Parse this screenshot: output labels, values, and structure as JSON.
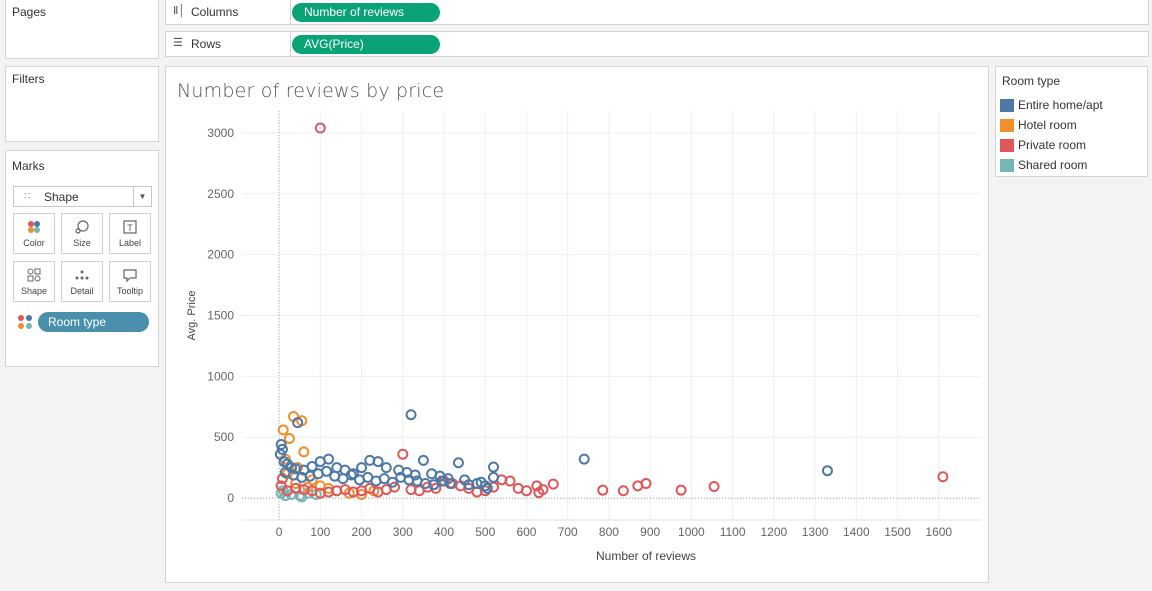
{
  "panels": {
    "pages_title": "Pages",
    "filters_title": "Filters",
    "marks_title": "Marks"
  },
  "marks": {
    "mark_type": "Shape",
    "buttons": [
      {
        "label": "Color",
        "icon": "color-icon"
      },
      {
        "label": "Size",
        "icon": "size-icon"
      },
      {
        "label": "Label",
        "icon": "label-icon"
      },
      {
        "label": "Shape",
        "icon": "shape-icon"
      },
      {
        "label": "Detail",
        "icon": "detail-icon"
      },
      {
        "label": "Tooltip",
        "icon": "tooltip-icon"
      }
    ],
    "color_pill": "Room type"
  },
  "shelves": {
    "columns_label": "Columns",
    "columns_pill": "Number of reviews",
    "rows_label": "Rows",
    "rows_pill": "AVG(Price)"
  },
  "legend": {
    "title": "Room type",
    "items": [
      {
        "label": "Entire home/apt",
        "color": "#4e79a7"
      },
      {
        "label": "Hotel room",
        "color": "#f28e2b"
      },
      {
        "label": "Private room",
        "color": "#e15759"
      },
      {
        "label": "Shared room",
        "color": "#76b7b2"
      }
    ]
  },
  "colors": {
    "pill_dimension": "#4a90ad",
    "pill_measure": "#0aa377"
  },
  "chart_data": {
    "type": "scatter",
    "title": "Number of reviews by price",
    "xlabel": "Number of reviews",
    "ylabel": "Avg. Price",
    "xlim": [
      -90,
      1700
    ],
    "ylim": [
      -180,
      3180
    ],
    "xticks": [
      0,
      100,
      200,
      300,
      400,
      500,
      600,
      700,
      800,
      900,
      1000,
      1100,
      1200,
      1300,
      1400,
      1500,
      1600
    ],
    "yticks": [
      0,
      500,
      1000,
      1500,
      2000,
      2500,
      3000
    ],
    "grid": true,
    "legend_position": "right",
    "series": [
      {
        "name": "Entire home/apt",
        "color": "#4e79a7",
        "points": [
          [
            320,
            685
          ],
          [
            45,
            620
          ],
          [
            1330,
            225
          ],
          [
            740,
            320
          ],
          [
            520,
            255
          ],
          [
            435,
            290
          ],
          [
            5,
            440
          ],
          [
            8,
            400
          ],
          [
            3,
            360
          ],
          [
            12,
            300
          ],
          [
            20,
            280
          ],
          [
            30,
            250
          ],
          [
            40,
            240
          ],
          [
            60,
            230
          ],
          [
            80,
            260
          ],
          [
            100,
            300
          ],
          [
            120,
            320
          ],
          [
            140,
            250
          ],
          [
            160,
            230
          ],
          [
            180,
            200
          ],
          [
            200,
            250
          ],
          [
            220,
            310
          ],
          [
            240,
            300
          ],
          [
            260,
            250
          ],
          [
            290,
            230
          ],
          [
            310,
            210
          ],
          [
            330,
            190
          ],
          [
            350,
            310
          ],
          [
            370,
            200
          ],
          [
            390,
            180
          ],
          [
            410,
            160
          ],
          [
            450,
            150
          ],
          [
            480,
            120
          ],
          [
            500,
            100
          ],
          [
            520,
            170
          ],
          [
            15,
            210
          ],
          [
            35,
            190
          ],
          [
            55,
            170
          ],
          [
            75,
            180
          ],
          [
            95,
            200
          ],
          [
            115,
            220
          ],
          [
            135,
            180
          ],
          [
            155,
            160
          ],
          [
            175,
            190
          ],
          [
            195,
            150
          ],
          [
            215,
            170
          ],
          [
            235,
            140
          ],
          [
            255,
            160
          ],
          [
            275,
            130
          ],
          [
            295,
            170
          ],
          [
            315,
            150
          ],
          [
            335,
            140
          ],
          [
            355,
            120
          ],
          [
            375,
            110
          ],
          [
            395,
            140
          ],
          [
            415,
            120
          ],
          [
            460,
            110
          ],
          [
            490,
            130
          ],
          [
            505,
            80
          ]
        ]
      },
      {
        "name": "Hotel room",
        "color": "#f28e2b",
        "points": [
          [
            35,
            670
          ],
          [
            55,
            635
          ],
          [
            10,
            560
          ],
          [
            25,
            490
          ],
          [
            60,
            380
          ],
          [
            15,
            320
          ],
          [
            45,
            250
          ],
          [
            80,
            150
          ],
          [
            100,
            100
          ],
          [
            120,
            80
          ],
          [
            140,
            60
          ],
          [
            170,
            40
          ],
          [
            200,
            30
          ],
          [
            230,
            60
          ],
          [
            40,
            120
          ],
          [
            70,
            90
          ],
          [
            20,
            200
          ]
        ]
      },
      {
        "name": "Private room",
        "color": "#e15759",
        "points": [
          [
            100,
            3040
          ],
          [
            1610,
            175
          ],
          [
            1055,
            95
          ],
          [
            975,
            65
          ],
          [
            890,
            120
          ],
          [
            870,
            100
          ],
          [
            835,
            60
          ],
          [
            785,
            65
          ],
          [
            665,
            115
          ],
          [
            640,
            70
          ],
          [
            625,
            100
          ],
          [
            600,
            60
          ],
          [
            580,
            80
          ],
          [
            560,
            140
          ],
          [
            540,
            150
          ],
          [
            520,
            90
          ],
          [
            500,
            60
          ],
          [
            480,
            50
          ],
          [
            460,
            80
          ],
          [
            440,
            100
          ],
          [
            420,
            120
          ],
          [
            400,
            140
          ],
          [
            380,
            80
          ],
          [
            360,
            90
          ],
          [
            340,
            60
          ],
          [
            320,
            70
          ],
          [
            300,
            360
          ],
          [
            280,
            90
          ],
          [
            260,
            70
          ],
          [
            240,
            50
          ],
          [
            220,
            80
          ],
          [
            200,
            60
          ],
          [
            180,
            50
          ],
          [
            160,
            70
          ],
          [
            140,
            60
          ],
          [
            120,
            50
          ],
          [
            100,
            40
          ],
          [
            80,
            60
          ],
          [
            60,
            70
          ],
          [
            40,
            80
          ],
          [
            20,
            60
          ],
          [
            5,
            100
          ],
          [
            8,
            160
          ],
          [
            630,
            45
          ]
        ]
      },
      {
        "name": "Shared room",
        "color": "#76b7b2",
        "points": [
          [
            5,
            40
          ],
          [
            15,
            20
          ],
          [
            30,
            30
          ],
          [
            50,
            20
          ],
          [
            70,
            40
          ],
          [
            90,
            30
          ],
          [
            10,
            60
          ],
          [
            55,
            10
          ]
        ]
      }
    ]
  }
}
